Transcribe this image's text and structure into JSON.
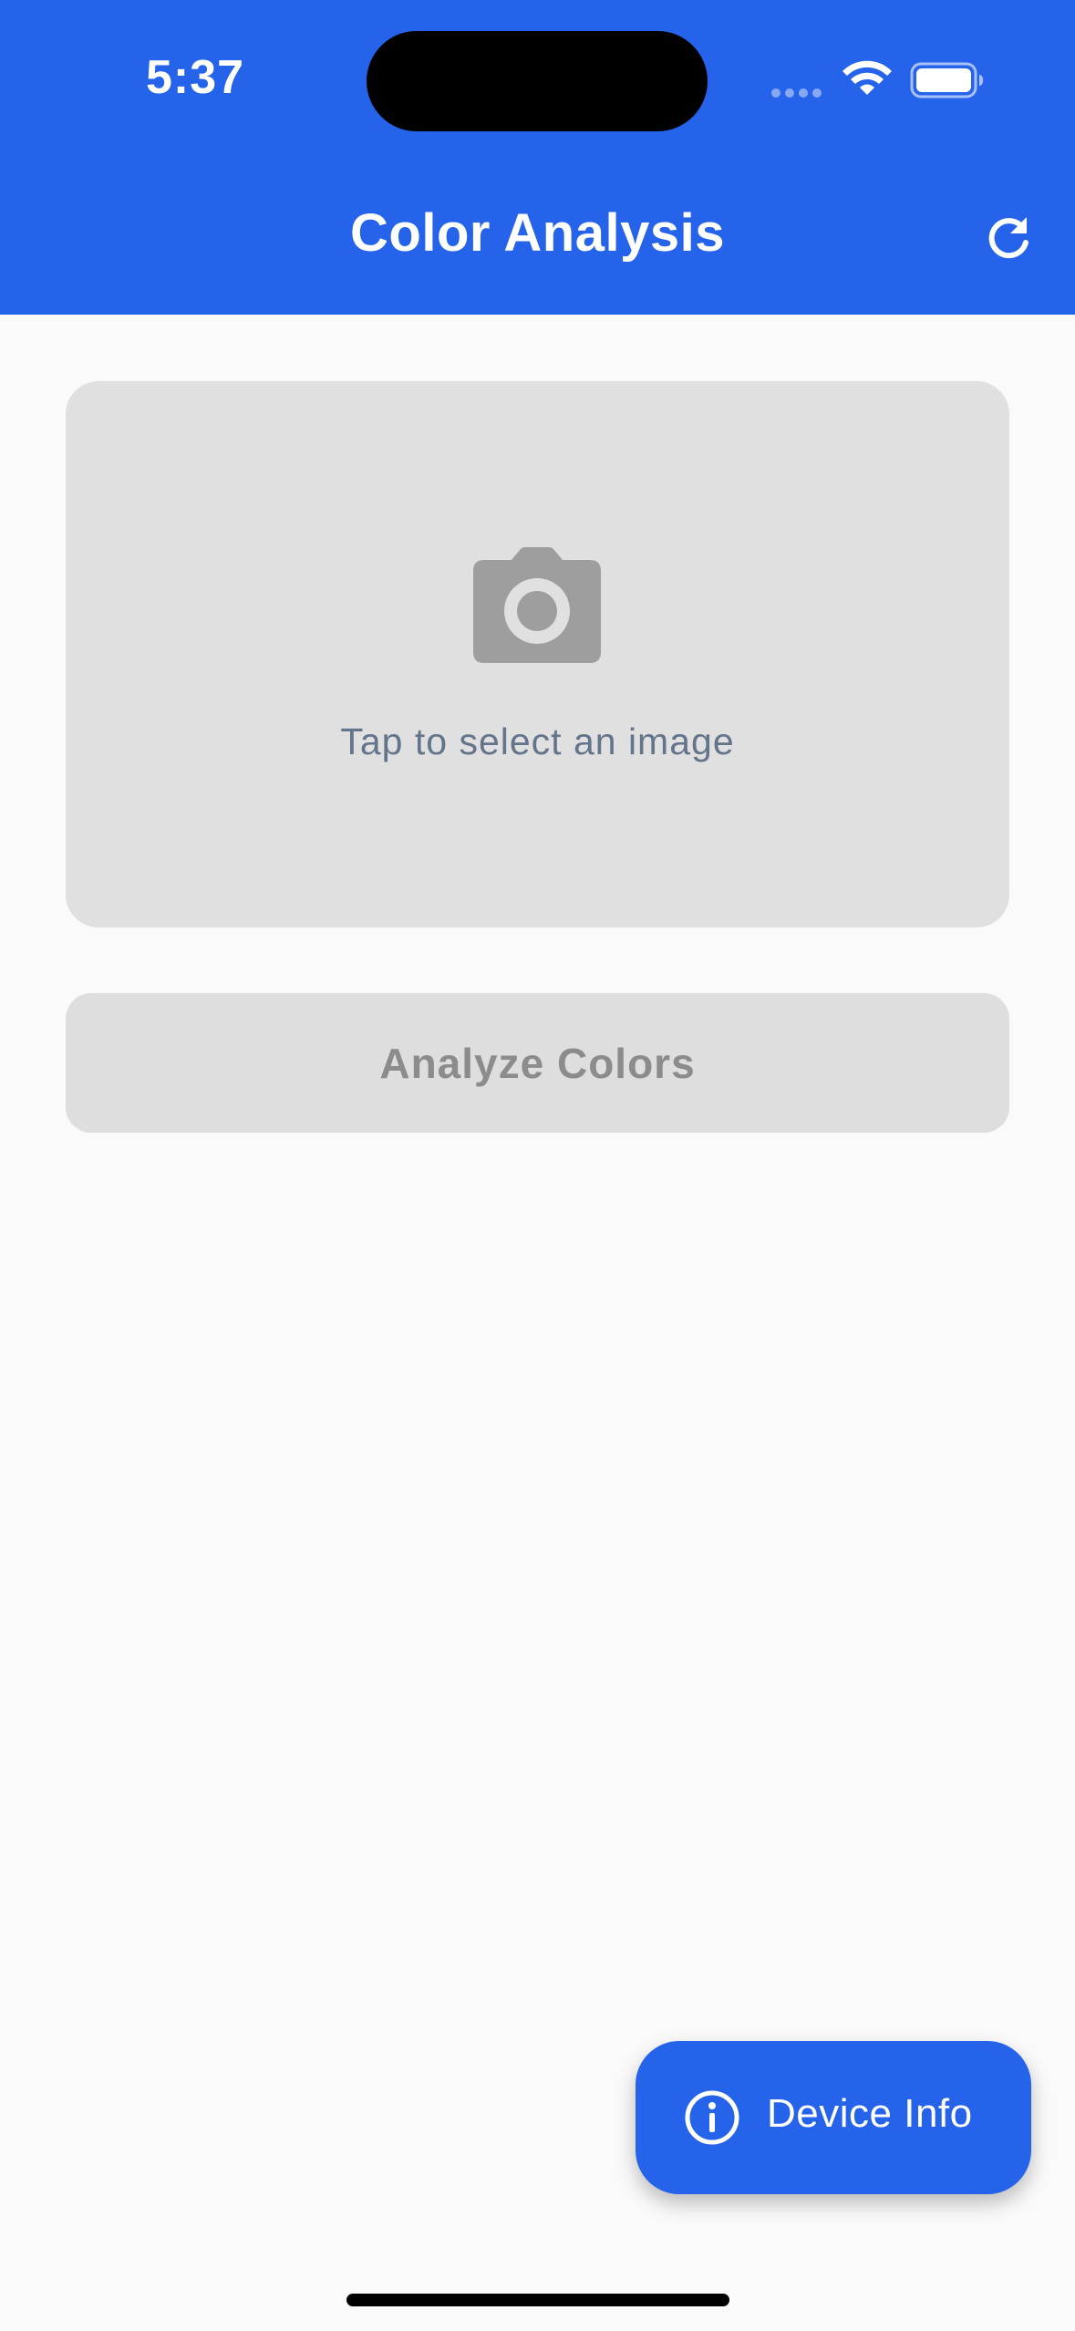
{
  "status_bar": {
    "time": "5:37"
  },
  "app_bar": {
    "title": "Color Analysis",
    "refresh_icon": "refresh-icon"
  },
  "image_picker": {
    "icon": "camera-icon",
    "prompt": "Tap to select an image"
  },
  "analyze_button": {
    "label": "Analyze Colors",
    "enabled": false
  },
  "fab": {
    "icon": "info-icon",
    "label": "Device Info"
  },
  "colors": {
    "primary": "#2563eb",
    "background": "#fafafa",
    "picker_bg": "#e0e0e0",
    "disabled_button_bg": "#dedede",
    "disabled_text": "#8c8c8c",
    "hint_text": "#64748b",
    "camera_icon": "#9e9e9e"
  }
}
